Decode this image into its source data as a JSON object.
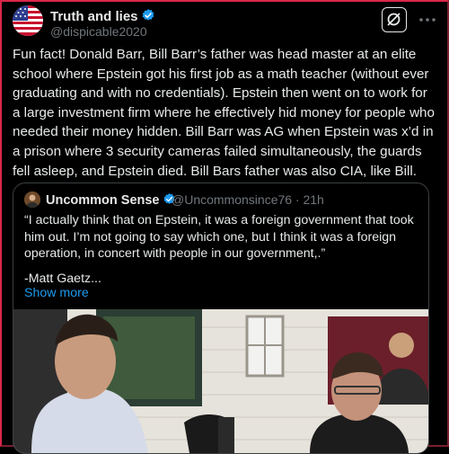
{
  "tweet": {
    "display_name": "Truth and lies",
    "handle": "@dispicable2020",
    "text": "Fun fact! Donald Barr, Bill Barr’s father was head master  at an elite school where Epstein got his first job as a math teacher (without ever graduating and with no credentials). Epstein then went on to work for a large investment firm where he effectively hid money for  people who needed their money hidden. Bill Barr was AG when Epstein was x’d in a prison where 3 security cameras failed simultaneously, the guards fell asleep, and Epstein died. Bill Bars father was also CIA, like Bill."
  },
  "quote": {
    "display_name": "Uncommon Sense",
    "handle_time": "@Uncommonsince76 · 21h",
    "text": "“I actually think that on Epstein, it was a foreign government that took him out. I’m not going to say which one, but I think it was a foreign operation, in concert with people in our government,.”",
    "signature": "-Matt Gaetz...",
    "show_more": "Show more"
  },
  "colors": {
    "background": "#000000",
    "text": "#e7e9ea",
    "secondary": "#71767b",
    "link": "#1d9bf0",
    "verified": "#1d9bf0",
    "border": "#3c4044"
  },
  "icons": [
    "verified-badge-icon",
    "grok-icon",
    "more-options-icon"
  ]
}
